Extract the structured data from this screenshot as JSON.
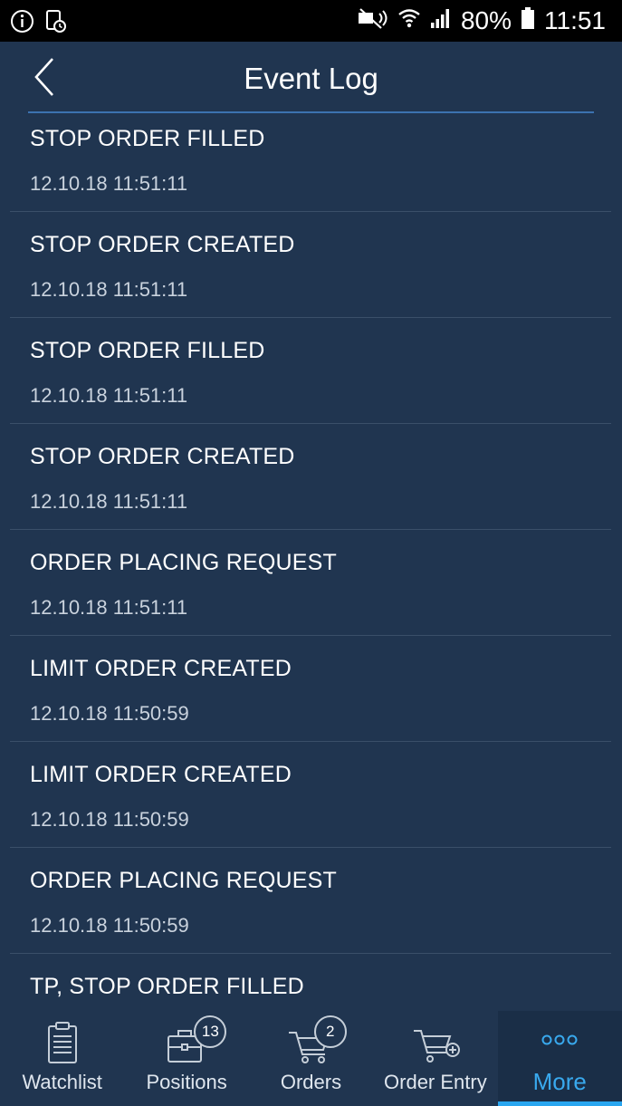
{
  "status_bar": {
    "battery_percent": "80%",
    "time": "11:51",
    "left_icons": [
      "info-icon",
      "screen-record-icon"
    ],
    "right_icons": [
      "mute-icon",
      "wifi-icon",
      "signal-icon",
      "battery-icon"
    ]
  },
  "header": {
    "title": "Event Log",
    "back_icon": "chevron-left-icon"
  },
  "events": [
    {
      "title": "STOP ORDER FILLED",
      "time": "12.10.18 11:51:11"
    },
    {
      "title": "STOP ORDER CREATED",
      "time": "12.10.18 11:51:11"
    },
    {
      "title": "STOP ORDER FILLED",
      "time": "12.10.18 11:51:11"
    },
    {
      "title": "STOP ORDER CREATED",
      "time": "12.10.18 11:51:11"
    },
    {
      "title": "ORDER PLACING REQUEST",
      "time": "12.10.18 11:51:11"
    },
    {
      "title": "LIMIT ORDER CREATED",
      "time": "12.10.18 11:50:59"
    },
    {
      "title": "LIMIT ORDER CREATED",
      "time": "12.10.18 11:50:59"
    },
    {
      "title": "ORDER PLACING REQUEST",
      "time": "12.10.18 11:50:59"
    },
    {
      "title": "TP, STOP ORDER FILLED",
      "time": ""
    }
  ],
  "bottom_nav": {
    "items": [
      {
        "label": "Watchlist",
        "icon": "clipboard-icon",
        "badge": ""
      },
      {
        "label": "Positions",
        "icon": "briefcase-icon",
        "badge": "13"
      },
      {
        "label": "Orders",
        "icon": "cart-icon",
        "badge": "2"
      },
      {
        "label": "Order Entry",
        "icon": "cart-add-icon",
        "badge": ""
      },
      {
        "label": "More",
        "icon": "more-dots-icon",
        "badge": ""
      }
    ],
    "active": "More"
  },
  "colors": {
    "background": "#203550",
    "accent": "#39a9ee",
    "header_rule": "#3c72b0"
  }
}
